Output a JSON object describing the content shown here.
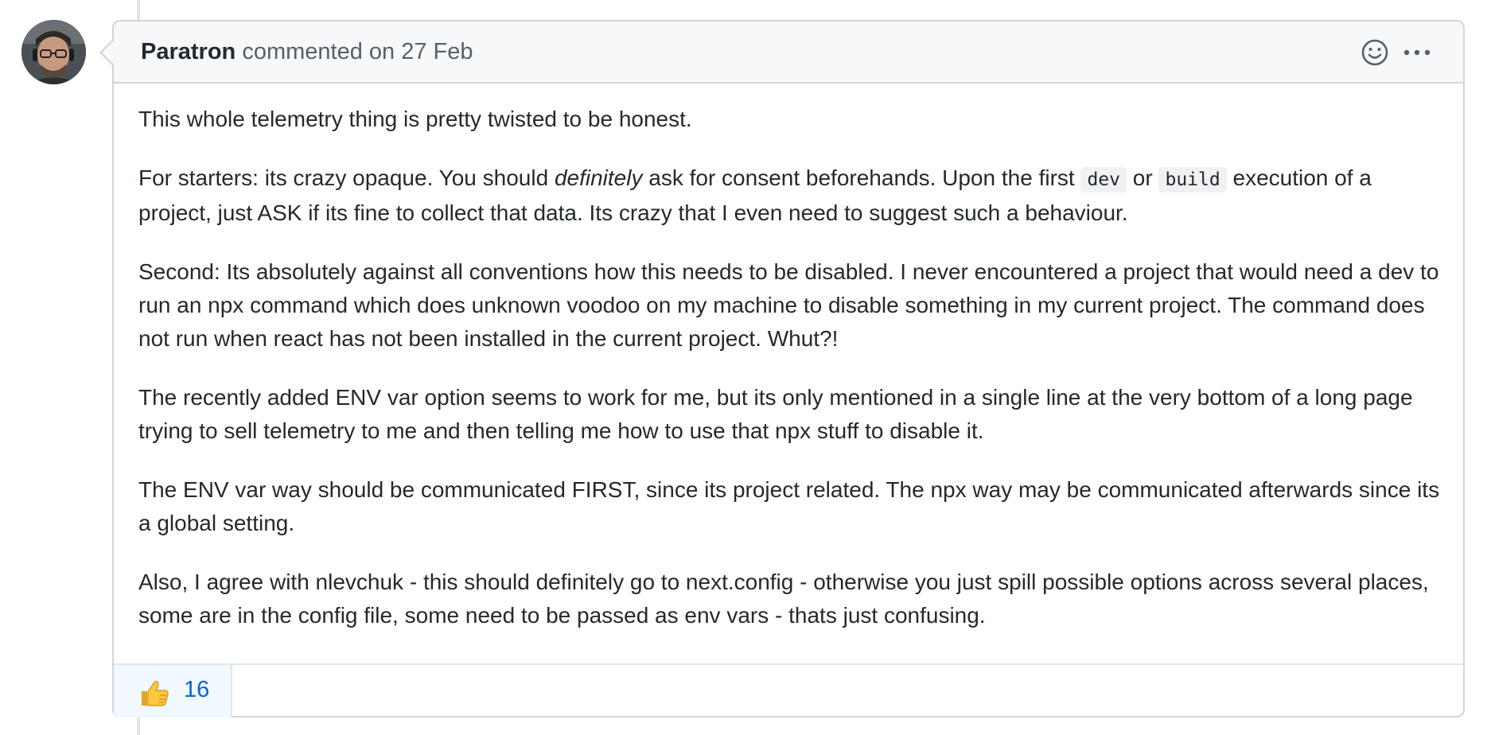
{
  "comment": {
    "author": "Paratron",
    "action_text": "commented on 27 Feb",
    "avatar_icon": "user-avatar",
    "header_icons": [
      "smiley-icon",
      "kebab-horizontal-icon"
    ],
    "body": {
      "p1": "This whole telemetry thing is pretty twisted to be honest.",
      "p2_a": "For starters: its crazy opaque. You should ",
      "p2_em": "definitely",
      "p2_b": " ask for consent beforehands. Upon the first ",
      "p2_code1": "dev",
      "p2_c": " or ",
      "p2_code2": "build",
      "p2_d": " execution of a project, just ASK if its fine to collect that data. Its crazy that I even need to suggest such a behaviour.",
      "p3": "Second: Its absolutely against all conventions how this needs to be disabled. I never encountered a project that would need a dev to run an npx command which does unknown voodoo on my machine to disable something in my current project. The command does not run when react has not been installed in the current project. Whut?!",
      "p4": "The recently added ENV var option seems to work for me, but its only mentioned in a single line at the very bottom of a long page trying to sell telemetry to me and then telling me how to use that npx stuff to disable it.",
      "p5": "The ENV var way should be communicated FIRST, since its project related. The npx way may be communicated afterwards since its a global setting.",
      "p6": "Also, I agree with nlevchuk - this should definitely go to next.config - otherwise you just spill possible options across several places, some are in the config file, some need to be passed as env vars - thats just confusing."
    },
    "reactions": [
      {
        "emoji": "thumbs-up-icon",
        "count": "16"
      }
    ]
  },
  "colors": {
    "border": "#d1d5da",
    "header_bg": "#f6f8fa",
    "text": "#24292e",
    "muted": "#586069",
    "link": "#0366d6",
    "reaction_bg": "#f1f8ff"
  }
}
